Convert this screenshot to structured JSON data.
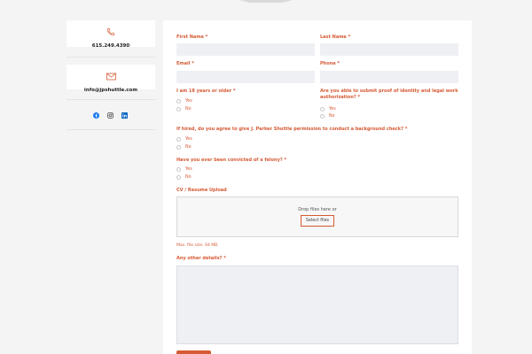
{
  "contact": {
    "phone": "615.249.4390",
    "email": "info@jpshuttle.com",
    "icons": [
      "phone-icon",
      "envelope-icon",
      "facebook-icon",
      "instagram-icon",
      "linkedin-icon"
    ]
  },
  "form": {
    "first_name_label": "First Name",
    "last_name_label": "Last Name",
    "email_label": "Email",
    "phone_label": "Phone",
    "age_question": "I am 18 years or older",
    "proof_question_line1": "Are you able to submit proof of identity and legal work",
    "proof_question_line2": "authorization?",
    "background_question": "If hired, do you agree to give J. Parker Shuttle permission to conduct a background check?",
    "felony_question": "Have you ever been convicted of a felony?",
    "cv_label": "CV / Resume Upload",
    "drop_text": "Drop files here or",
    "select_files": "Select files",
    "max_size": "Max. file size: 64 MB.",
    "details_label": "Any other details?",
    "yes": "Yes",
    "no": "No",
    "required_mark": "*"
  },
  "colors": {
    "accent": "#d65a34",
    "input_bg": "#eef0f4",
    "page_bg": "#f4f4f4"
  }
}
